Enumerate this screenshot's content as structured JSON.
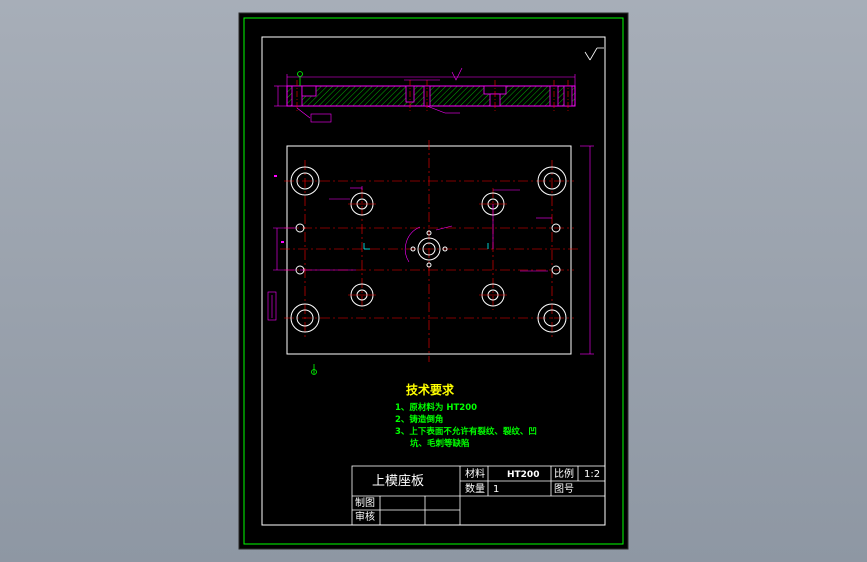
{
  "drawing": {
    "background": "#000000",
    "border_color": "#00ff00",
    "frame_color": "#ffffff",
    "outline_color": "#ff00ff",
    "centerline_color": "#ff0000",
    "hatch_color": "#00a000",
    "dimension_color": "#ff00ff"
  },
  "title_block": {
    "part_name": "上模座板",
    "material_label": "材料",
    "material_value": "HT200",
    "ratio_label": "比例",
    "ratio_value": "1:2",
    "quantity_label": "数量",
    "quantity_value": "1",
    "drawing_no_label": "图号",
    "drawn_label": "制图",
    "checked_label": "审核"
  },
  "technical_requirements": {
    "title": "技术要求",
    "lines": [
      "1、原材料为 HT200",
      "2、铸造倒角",
      "3、上下表面不允许有裂纹、裂纹、凹",
      "坑、毛刺等缺陷"
    ]
  }
}
